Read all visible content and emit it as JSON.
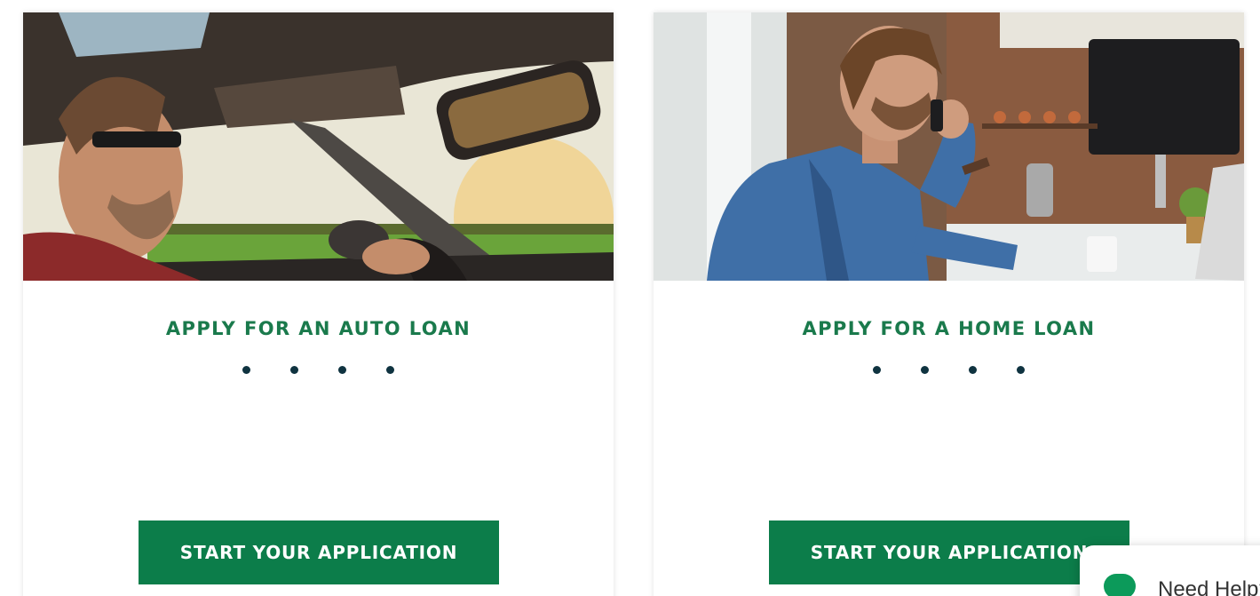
{
  "cards": [
    {
      "image": "man-driving-car-photo",
      "title": "APPLY FOR AN AUTO LOAN",
      "button_label": "START YOUR APPLICATION"
    },
    {
      "image": "man-on-phone-laptop-photo",
      "title": "APPLY FOR A HOME LOAN",
      "button_label": "START YOUR APPLICATION"
    }
  ],
  "help_widget": {
    "label": "Need Help?",
    "icon": "chat-bubble-icon"
  },
  "colors": {
    "title_green": "#1a7a4c",
    "button_green": "#0c7d4a",
    "dot_navy": "#0f3340"
  }
}
